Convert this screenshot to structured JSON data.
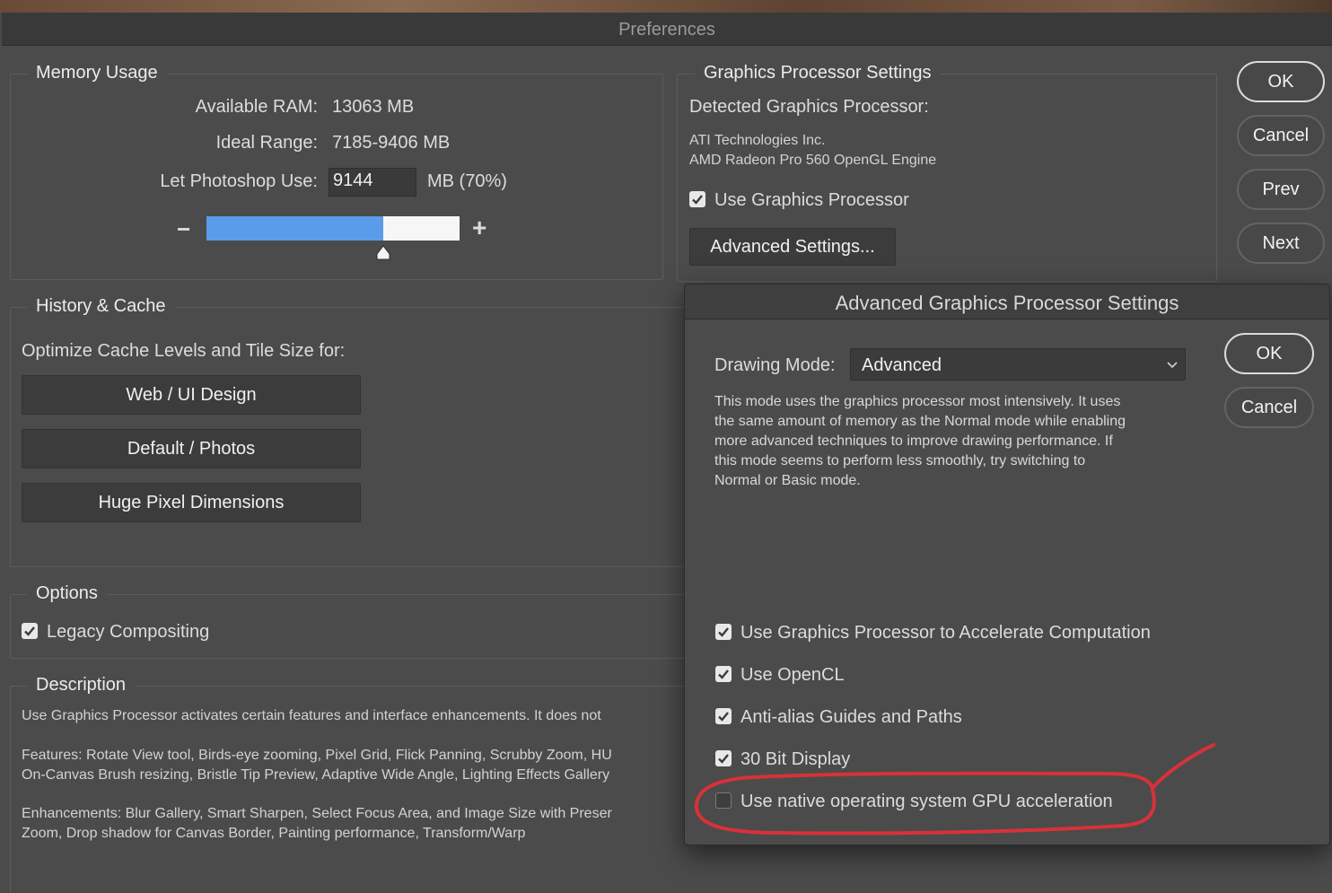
{
  "window": {
    "title": "Preferences"
  },
  "memory": {
    "legend": "Memory Usage",
    "available_label": "Available RAM:",
    "available_value": "13063 MB",
    "ideal_label": "Ideal Range:",
    "ideal_value": "7185-9406 MB",
    "let_label": "Let Photoshop Use:",
    "let_value": "9144",
    "let_suffix": "MB (70%)",
    "minus": "−",
    "plus": "+",
    "slider_fraction": 0.7
  },
  "gpu": {
    "legend": "Graphics Processor Settings",
    "detected_label": "Detected Graphics Processor:",
    "vendor": "ATI Technologies Inc.",
    "model": "AMD Radeon Pro 560 OpenGL Engine",
    "use_gpu_label": "Use Graphics Processor",
    "use_gpu_checked": true,
    "advanced_button": "Advanced Settings..."
  },
  "side_buttons": {
    "ok": "OK",
    "cancel": "Cancel",
    "prev": "Prev",
    "next": "Next"
  },
  "history": {
    "legend": "History & Cache",
    "optimize_label": "Optimize Cache Levels and Tile Size for:",
    "buttons": [
      "Web / UI Design",
      "Default / Photos",
      "Huge Pixel Dimensions"
    ]
  },
  "options": {
    "legend": "Options",
    "legacy_label": "Legacy Compositing",
    "legacy_checked": true
  },
  "description": {
    "legend": "Description",
    "p1": "Use Graphics Processor activates certain features and interface enhancements. It does not",
    "p2a": "Features: Rotate View tool, Birds-eye zooming, Pixel Grid, Flick Panning, Scrubby Zoom, HU",
    "p2b": "On-Canvas Brush resizing, Bristle Tip Preview, Adaptive Wide Angle, Lighting Effects Gallery",
    "p3a": "Enhancements: Blur Gallery, Smart Sharpen, Select Focus Area, and Image Size with Preser",
    "p3b": "Zoom, Drop shadow for Canvas Border, Painting performance, Transform/Warp"
  },
  "advanced_dialog": {
    "title": "Advanced Graphics Processor Settings",
    "drawing_mode_label": "Drawing Mode:",
    "drawing_mode_value": "Advanced",
    "mode_desc": [
      "This mode uses the graphics processor most intensively.  It uses",
      "the same amount of memory as the Normal mode while enabling",
      "more advanced techniques to improve drawing performance.  If",
      "this mode seems to perform less smoothly, try switching to",
      "Normal or Basic mode."
    ],
    "ok": "OK",
    "cancel": "Cancel",
    "checkboxes": [
      {
        "label": "Use Graphics Processor to Accelerate Computation",
        "checked": true
      },
      {
        "label": "Use OpenCL",
        "checked": true
      },
      {
        "label": "Anti-alias Guides and Paths",
        "checked": true
      },
      {
        "label": "30 Bit Display",
        "checked": true
      },
      {
        "label": "Use native operating system GPU acceleration",
        "checked": false
      }
    ]
  },
  "colors": {
    "slider_fill": "#5a9bea",
    "annotation": "#d8313a"
  }
}
